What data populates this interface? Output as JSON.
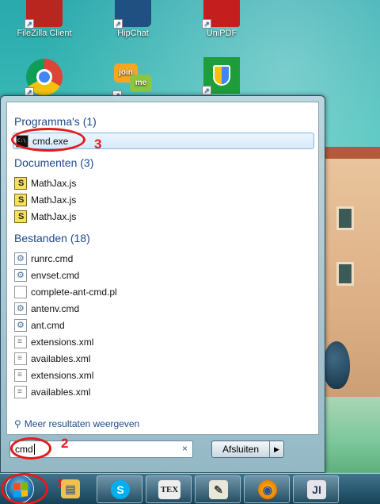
{
  "desktop": {
    "icons_top": [
      {
        "label": "FileZilla Client",
        "icon": "filezilla-icon",
        "color": "#b8261f"
      },
      {
        "label": "HipChat",
        "icon": "hipchat-icon",
        "color": "#205081"
      },
      {
        "label": "UniPDF",
        "icon": "unipdf-icon",
        "color": "#c41e1e"
      }
    ],
    "icons_row2": [
      {
        "icon": "chrome-icon"
      },
      {
        "icon": "joinme-icon",
        "text_a": "join",
        "text_b": "me"
      },
      {
        "icon": "security-shield-icon"
      }
    ]
  },
  "start_menu": {
    "groups": {
      "programs": {
        "heading": "Programma's (1)",
        "items": [
          {
            "label": "cmd.exe",
            "icon": "cmd-icon"
          }
        ]
      },
      "documents": {
        "heading": "Documenten (3)",
        "items": [
          {
            "label": "MathJax.js",
            "icon": "js-file-icon"
          },
          {
            "label": "MathJax.js",
            "icon": "js-file-icon"
          },
          {
            "label": "MathJax.js",
            "icon": "js-file-icon"
          }
        ]
      },
      "files": {
        "heading": "Bestanden (18)",
        "items": [
          {
            "label": "runrc.cmd",
            "icon": "cmd-script-icon"
          },
          {
            "label": "envset.cmd",
            "icon": "cmd-script-icon"
          },
          {
            "label": "complete-ant-cmd.pl",
            "icon": "blank-file-icon"
          },
          {
            "label": "antenv.cmd",
            "icon": "cmd-script-icon"
          },
          {
            "label": "ant.cmd",
            "icon": "cmd-script-icon"
          },
          {
            "label": "extensions.xml",
            "icon": "xml-file-icon"
          },
          {
            "label": "availables.xml",
            "icon": "xml-file-icon"
          },
          {
            "label": "extensions.xml",
            "icon": "xml-file-icon"
          },
          {
            "label": "availables.xml",
            "icon": "xml-file-icon"
          }
        ]
      }
    },
    "more_results": "Meer resultaten weergeven",
    "search": {
      "value": "cmd",
      "clear": "×"
    },
    "shutdown": {
      "label": "Afsluiten",
      "arrow": "▶"
    }
  },
  "annotations": {
    "step1": "1",
    "step2": "2",
    "step3": "3",
    "color": "#e21b1b"
  },
  "taskbar": {
    "buttons": [
      {
        "icon": "file-explorer-icon",
        "glyph": "▤"
      },
      {
        "icon": "skype-icon",
        "glyph": "S"
      },
      {
        "icon": "tex-editor-icon",
        "glyph": "TEX"
      },
      {
        "icon": "notepad-icon",
        "glyph": "✎"
      },
      {
        "icon": "firefox-icon",
        "glyph": "◉"
      },
      {
        "icon": "intellij-icon",
        "glyph": "JI"
      }
    ]
  }
}
